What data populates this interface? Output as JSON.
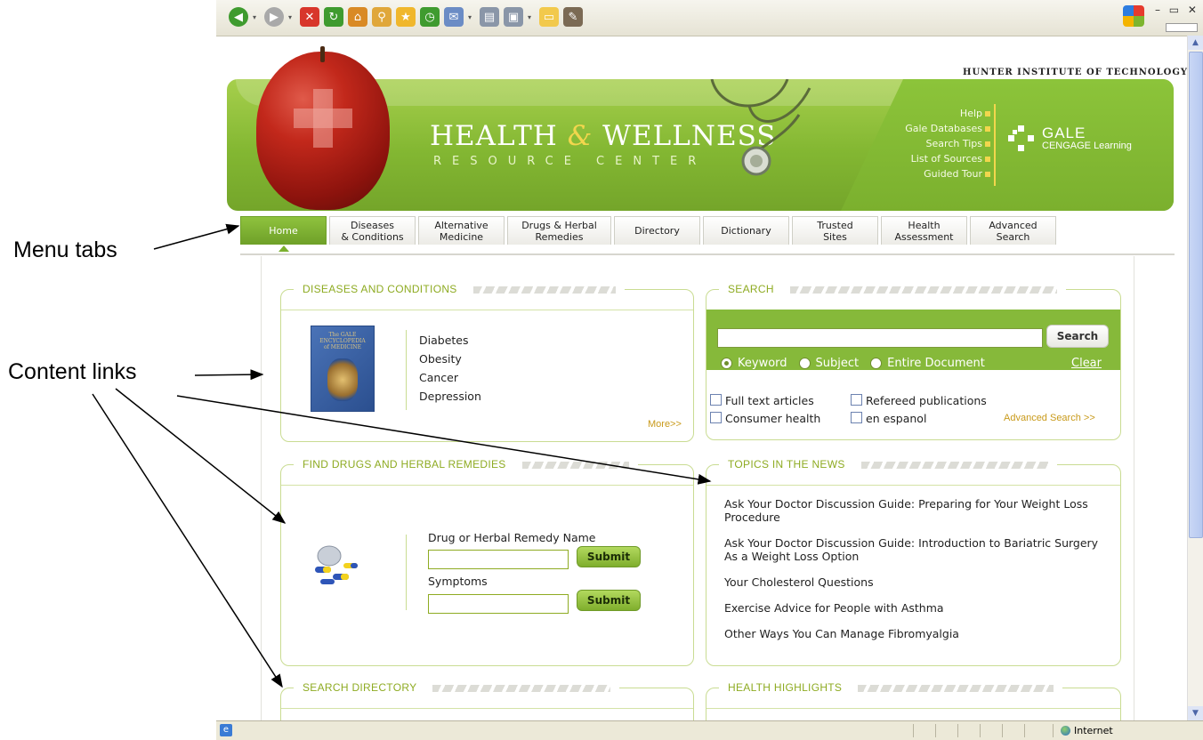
{
  "annotations": {
    "menu_tabs": "Menu tabs",
    "content_links": "Content links"
  },
  "toolbar_icons": [
    "back-icon",
    "forward-icon",
    "stop-icon",
    "refresh-icon",
    "home-icon",
    "search-icon",
    "favorites-icon",
    "history-icon",
    "mail-icon",
    "print-icon",
    "edit-icon",
    "notes-icon",
    "messenger-icon"
  ],
  "window": {
    "controls": "– ▭ ✕"
  },
  "header": {
    "institution": "HUNTER INSTITUTE OF TECHNOLOGY",
    "title_part1": "HEALTH",
    "title_amp": "&",
    "title_part2": "WELLNESS",
    "subtitle": "RESOURCE CENTER",
    "links": [
      "Help",
      "Gale Databases",
      "Search Tips",
      "List of Sources",
      "Guided Tour"
    ],
    "brand_line1": "GALE",
    "brand_line2": "CENGAGE Learning"
  },
  "tabs": [
    {
      "line1": "Home",
      "line2": ""
    },
    {
      "line1": "Diseases",
      "line2": "& Conditions"
    },
    {
      "line1": "Alternative",
      "line2": "Medicine"
    },
    {
      "line1": "Drugs & Herbal",
      "line2": "Remedies"
    },
    {
      "line1": "Directory",
      "line2": ""
    },
    {
      "line1": "Dictionary",
      "line2": ""
    },
    {
      "line1": "Trusted",
      "line2": "Sites"
    },
    {
      "line1": "Health",
      "line2": "Assessment"
    },
    {
      "line1": "Advanced",
      "line2": "Search"
    }
  ],
  "diseases": {
    "title": "DISEASES AND CONDITIONS",
    "book_title": "The GALE ENCYCLOPEDIA of MEDICINE",
    "links": [
      "Diabetes",
      "Obesity",
      "Cancer",
      "Depression"
    ],
    "more": "More>>"
  },
  "search": {
    "title": "SEARCH",
    "input_value": "",
    "button": "Search",
    "options": [
      "Keyword",
      "Subject",
      "Entire Document"
    ],
    "selected": "Keyword",
    "clear": "Clear",
    "checkboxes": [
      "Full text articles",
      "Refereed publications",
      "Consumer health",
      "en espanol"
    ],
    "advanced": "Advanced Search >>"
  },
  "drugs": {
    "title": "FIND DRUGS AND HERBAL REMEDIES",
    "name_label": "Drug or Herbal Remedy Name",
    "symptoms_label": "Symptoms",
    "submit": "Submit"
  },
  "news": {
    "title": "TOPICS IN THE NEWS",
    "items": [
      "Ask Your Doctor Discussion Guide: Preparing for Your Weight Loss Procedure",
      "Ask Your Doctor Discussion Guide: Introduction to Bariatric Surgery As a Weight Loss Option",
      "Your Cholesterol Questions",
      "Exercise Advice for People with Asthma",
      "Other Ways You Can Manage Fibromyalgia"
    ]
  },
  "directory": {
    "title": "SEARCH DIRECTORY"
  },
  "highlights": {
    "title": "HEALTH HIGHLIGHTS"
  },
  "status": {
    "zone": "Internet"
  }
}
